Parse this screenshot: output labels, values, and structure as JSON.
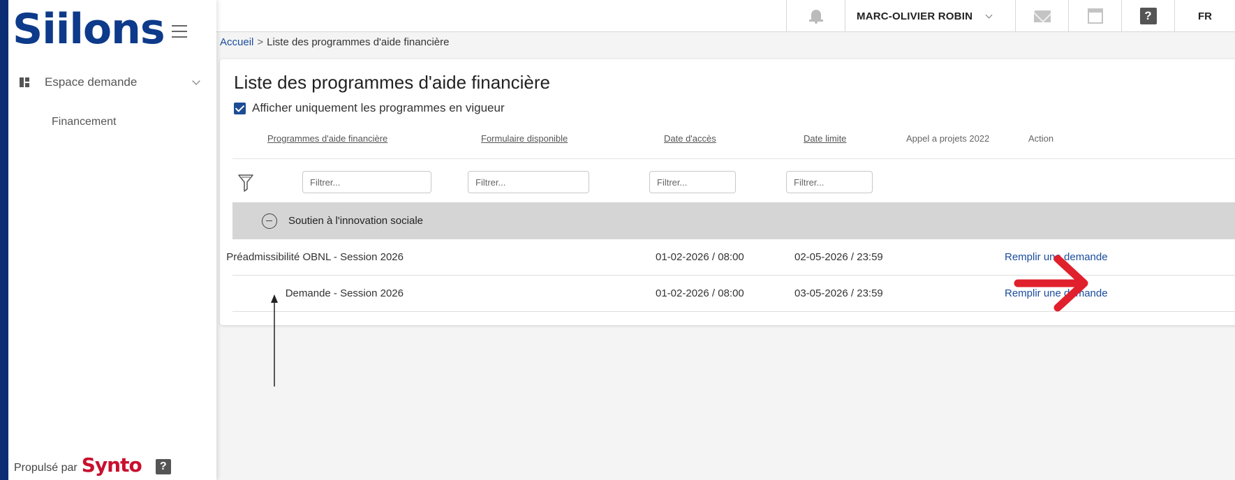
{
  "sidebar": {
    "logo_text": "Siilons",
    "nav_section_label": "Espace demande",
    "nav_sub_item": "Financement",
    "powered_label": "Propulsé par",
    "powered_brand": "Synto",
    "help_glyph": "?"
  },
  "topbar": {
    "user_name": "MARC-OLIVIER ROBIN",
    "help_glyph": "?",
    "language": "FR",
    "icons": [
      "bell-icon",
      "envelope-icon",
      "calendar-icon",
      "help-icon"
    ]
  },
  "breadcrumb": {
    "home": "Accueil",
    "separator": ">",
    "current": "Liste des programmes d'aide financière"
  },
  "page": {
    "title": "Liste des programmes d'aide financière",
    "checkbox_label": "Afficher uniquement les programmes en vigueur",
    "checkbox_checked": true
  },
  "table": {
    "columns": {
      "programmes": "Programmes d'aide financière",
      "formulaire": "Formulaire disponible",
      "date_acces": "Date d'accès",
      "date_limite": "Date limite",
      "appel": "Appel a projets 2022",
      "action": "Action"
    },
    "filter_placeholder": "Filtrer...",
    "group": {
      "label": "Soutien à l'innovation sociale"
    },
    "rows": [
      {
        "formulaire": "Préadmissibilité OBNL - Session 2026",
        "date_acces": "01-02-2026 / 08:00",
        "date_limite": "02-05-2026 / 23:59",
        "action": "Remplir une demande"
      },
      {
        "formulaire": "Demande - Session 2026",
        "date_acces": "01-02-2026 / 08:00",
        "date_limite": "03-05-2026 / 23:59",
        "action": "Remplir une demande"
      }
    ]
  },
  "colors": {
    "frame": "#0b2d73",
    "brand_blue": "#0d3a8a",
    "link_blue": "#1a4c9c",
    "group_row": "#d5d5d5",
    "annotation_red": "#e0202c",
    "synto_red": "#c8102e"
  }
}
